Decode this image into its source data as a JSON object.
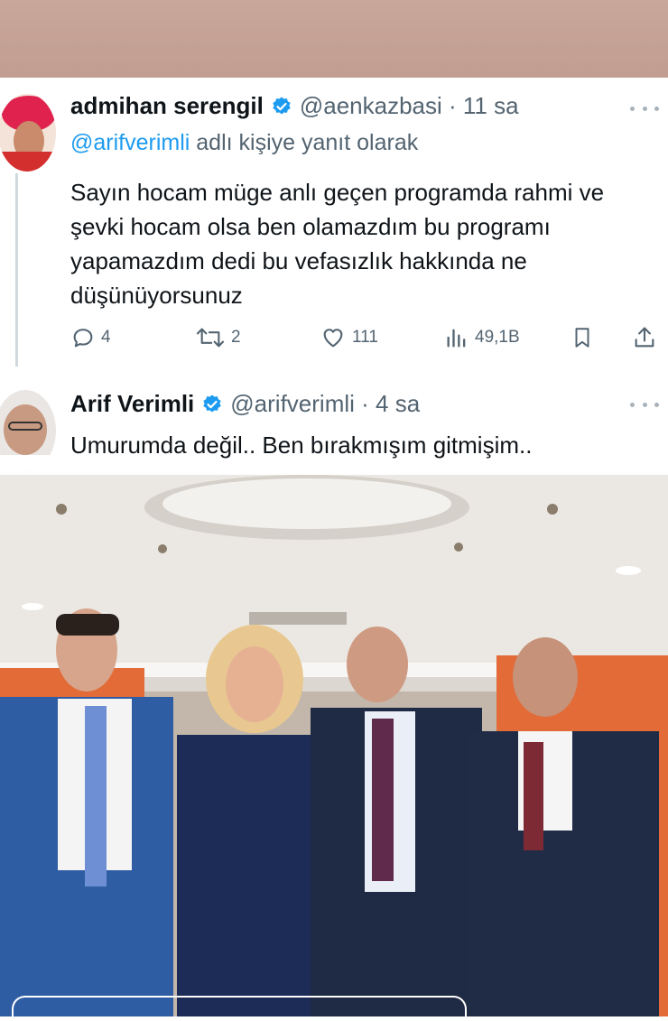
{
  "reply_tweet": {
    "display_name": "admihan serengil",
    "handle_time": "@aenkazbasi · 11 sa",
    "reply_prefix_mention": "@arifverimli",
    "reply_suffix": "adlı kişiye yanıt olarak",
    "text": "Sayın hocam müge anlı geçen programda rahmi ve şevki hocam olsa ben olamazdım bu programı yapamazdım dedi bu vefasızlık hakkında ne düşünüyorsunuz",
    "replies": "4",
    "retweets": "2",
    "likes": "111",
    "views": "49,1B",
    "icons": [
      "verified-badge-icon",
      "more-icon",
      "reply-icon",
      "retweet-icon",
      "like-icon",
      "views-icon",
      "bookmark-icon",
      "share-icon"
    ]
  },
  "answer_tweet": {
    "display_name": "Arif Verimli",
    "handle_time": "@arifverimli · 4 sa",
    "text": "Umurumda değil.. Ben bırakmışım gitmişim.."
  },
  "colors": {
    "accent": "#1d9bf0",
    "text": "#0f1419",
    "muted": "#536471",
    "top_band": "#c9a79b"
  }
}
